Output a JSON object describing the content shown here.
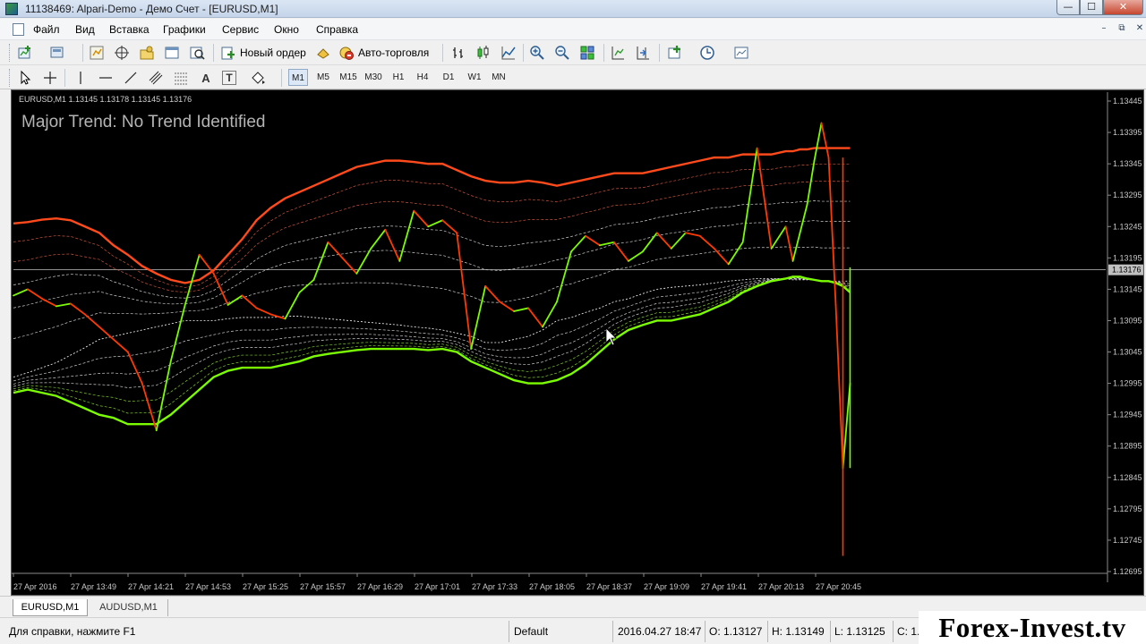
{
  "window": {
    "title": "11138469: Alpari-Demo - Демо Счет - [EURUSD,M1]",
    "minimize_glyph": "—",
    "maximize_glyph": "☐",
    "close_glyph": "✕"
  },
  "menu": {
    "items": [
      "Файл",
      "Вид",
      "Вставка",
      "Графики",
      "Сервис",
      "Окно",
      "Справка"
    ],
    "mdi_minimize": "–",
    "mdi_restore": "⧉",
    "mdi_close": "✕"
  },
  "toolbar": {
    "new_order_label": "Новый ордер",
    "autotrading_label": "Авто-торговля",
    "timeframes": [
      "M1",
      "M5",
      "M15",
      "M30",
      "H1",
      "H4",
      "D1",
      "W1",
      "MN"
    ],
    "active_timeframe": "M1",
    "text_tool_label": "A",
    "label_tool_label": "T",
    "search_placeholder": "",
    "icons": [
      "new-chart-icon",
      "profiles-icon",
      "market-watch-icon",
      "crosshair-navigator-icon",
      "data-window-icon",
      "terminal-icon",
      "strategy-tester-icon",
      "oil-can-icon",
      "autotrading-icon",
      "bar-chart-icon",
      "candlestick-icon",
      "line-chart-icon",
      "zoom-in-icon",
      "zoom-out-icon",
      "tile-windows-icon",
      "chart-shift-icon",
      "auto-scroll-icon",
      "indicators-icon",
      "periods-icon",
      "templates-icon",
      "cursor-icon",
      "crosshair-icon",
      "vertical-line-icon",
      "horizontal-line-icon",
      "trendline-icon",
      "channel-icon",
      "fibonacci-icon",
      "shapes-icon",
      "search-icon"
    ]
  },
  "chart": {
    "header": "EURUSD,M1  1.13145 1.13178 1.13145 1.13176",
    "indicator_text": "Major Trend: No Trend Identified",
    "current_price_label": "1.13176",
    "colors": {
      "background": "#000000",
      "price_up": "#7cfc00",
      "price_down": "#ff3a00",
      "upper_band": "#ff4a1c",
      "lower_band": "#7cfc00",
      "inner_bands": "#ffffff",
      "price_line": "#c0c0c0",
      "axis_text": "#c8c8c8"
    }
  },
  "chart_data": {
    "type": "line",
    "symbol": "EURUSD",
    "timeframe": "M1",
    "ylim": [
      1.12695,
      1.13445
    ],
    "y_ticks": [
      1.13445,
      1.13395,
      1.13345,
      1.13295,
      1.13245,
      1.13195,
      1.13145,
      1.13095,
      1.13045,
      1.12995,
      1.12945,
      1.12895,
      1.12845,
      1.12795,
      1.12745,
      1.12695
    ],
    "y_tick_labels": [
      "1.13445",
      "1.13395",
      "1.13345",
      "1.13295",
      "1.13245",
      "1.13195",
      "1.13145",
      "1.13095",
      "1.13045",
      "1.12995",
      "1.12945",
      "1.12895",
      "1.12845",
      "1.12795",
      "1.12745",
      "1.12695"
    ],
    "x_tick_labels": [
      "27 Apr 2016",
      "27 Apr 13:49",
      "27 Apr 14:21",
      "27 Apr 14:53",
      "27 Apr 15:25",
      "27 Apr 15:57",
      "27 Apr 16:29",
      "27 Apr 17:01",
      "27 Apr 17:33",
      "27 Apr 18:05",
      "27 Apr 18:37",
      "27 Apr 19:09",
      "27 Apr 19:41",
      "27 Apr 20:13",
      "27 Apr 20:45"
    ],
    "x_index": [
      0,
      16,
      32,
      48,
      64,
      80,
      96,
      112,
      128,
      144,
      160,
      176,
      192,
      208,
      224,
      240,
      256,
      272,
      288,
      304,
      320,
      336,
      352,
      368,
      384,
      400,
      416,
      432,
      448,
      464,
      480,
      496,
      512,
      528,
      544,
      560,
      576,
      592,
      608,
      624,
      640,
      656,
      672,
      688,
      704,
      720,
      736,
      752,
      768,
      784,
      800,
      816,
      832,
      848,
      864,
      872,
      880,
      888,
      896,
      904,
      912,
      920,
      928,
      936
    ],
    "series": [
      {
        "values": [
          1.13135,
          1.13145,
          1.1313,
          1.13118,
          1.13122,
          1.13105,
          1.13085,
          1.13065,
          1.13045,
          1.12995,
          1.1292,
          1.1303,
          1.1312,
          1.132,
          1.1317,
          1.1312,
          1.13135,
          1.13115,
          1.13105,
          1.13098,
          1.1314,
          1.1316,
          1.1322,
          1.13195,
          1.1317,
          1.1321,
          1.1324,
          1.1319,
          1.1327,
          1.13245,
          1.13255,
          1.13235,
          1.1305,
          1.1315,
          1.13125,
          1.1311,
          1.13115,
          1.13085,
          1.13125,
          1.13205,
          1.1323,
          1.13215,
          1.1322,
          1.1319,
          1.13205,
          1.13235,
          1.1321,
          1.13235,
          1.1323,
          1.1321,
          1.13185,
          1.1322,
          1.1337,
          1.1321,
          1.13245,
          1.1319,
          1.13235,
          1.1328,
          1.1335,
          1.1341,
          1.13355,
          1.1312,
          1.1286,
          1.12995
        ]
      },
      {
        "name": "",
        "values": [
          1.13005,
          1.13012,
          1.1302,
          1.13028,
          1.1304,
          1.13052,
          1.13065,
          1.1307,
          1.13075,
          1.1308,
          1.13085,
          1.1309,
          1.13095,
          1.13095,
          1.13095,
          1.13098,
          1.131,
          1.131,
          1.131,
          1.13102,
          1.13102,
          1.131,
          1.13098,
          1.13096,
          1.13094,
          1.13092,
          1.1309,
          1.13088,
          1.13085,
          1.13083,
          1.1308,
          1.13075,
          1.1307,
          1.1306,
          1.1306,
          1.13065,
          1.1307,
          1.1308,
          1.13095,
          1.131,
          1.13108,
          1.13115,
          1.13125,
          1.1313,
          1.13138,
          1.13145,
          1.13148,
          1.1315,
          1.13152,
          1.13155,
          1.13158,
          1.1316,
          1.13162,
          1.13162,
          1.13162,
          1.1316,
          1.1316,
          1.1316,
          1.1316,
          1.13158,
          1.13158,
          1.13158,
          1.13158,
          1.13158
        ]
      }
    ],
    "upper_band": [
      1.1325,
      1.13252,
      1.13256,
      1.13258,
      1.13255,
      1.13245,
      1.13235,
      1.13215,
      1.132,
      1.13182,
      1.1317,
      1.1316,
      1.13155,
      1.1316,
      1.13175,
      1.132,
      1.13225,
      1.13255,
      1.13275,
      1.1329,
      1.133,
      1.1331,
      1.1332,
      1.1333,
      1.1334,
      1.13345,
      1.1335,
      1.1335,
      1.13348,
      1.13345,
      1.13345,
      1.13335,
      1.13325,
      1.13318,
      1.13315,
      1.13315,
      1.13318,
      1.13315,
      1.1331,
      1.13315,
      1.1332,
      1.13325,
      1.1333,
      1.1333,
      1.1333,
      1.13335,
      1.1334,
      1.13345,
      1.1335,
      1.13355,
      1.13355,
      1.1336,
      1.1336,
      1.1336,
      1.13365,
      1.13365,
      1.13368,
      1.13368,
      1.1337,
      1.1337,
      1.1337,
      1.1337,
      1.1337,
      1.1337
    ],
    "lower_band": [
      1.1298,
      1.12985,
      1.1298,
      1.12975,
      1.12965,
      1.12955,
      1.12945,
      1.1294,
      1.1293,
      1.1293,
      1.1293,
      1.12945,
      1.12965,
      1.12985,
      1.13005,
      1.13015,
      1.1302,
      1.1302,
      1.1302,
      1.13025,
      1.1303,
      1.13038,
      1.13042,
      1.13045,
      1.13048,
      1.1305,
      1.1305,
      1.1305,
      1.1305,
      1.13048,
      1.1305,
      1.13045,
      1.1303,
      1.1302,
      1.1301,
      1.13,
      1.12995,
      1.12995,
      1.13,
      1.1301,
      1.13025,
      1.13045,
      1.13065,
      1.1308,
      1.13088,
      1.13095,
      1.13095,
      1.131,
      1.13105,
      1.13115,
      1.13125,
      1.1314,
      1.1315,
      1.13158,
      1.13162,
      1.13165,
      1.13165,
      1.13162,
      1.1316,
      1.13158,
      1.13158,
      1.13155,
      1.1315,
      1.1314
    ],
    "price_line": 1.13176,
    "grid": false
  },
  "tabs": [
    "EURUSD,M1",
    "AUDUSD,M1"
  ],
  "active_tab": "EURUSD,M1",
  "status": {
    "help": "Для справки, нажмите F1",
    "profile": "Default",
    "datetime": "2016.04.27 18:47",
    "open": "O: 1.13127",
    "high": "H: 1.13149",
    "low": "L: 1.13125",
    "close": "C: 1."
  },
  "watermark": "Forex-Invest.tv"
}
